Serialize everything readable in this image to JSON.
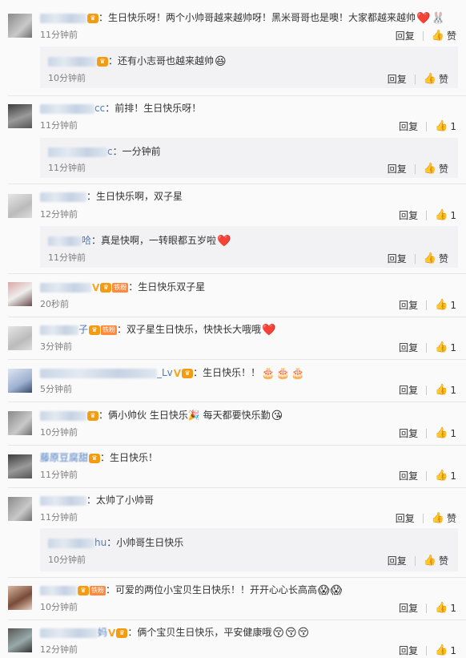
{
  "ui": {
    "reply_label": "回复",
    "like_label": "赞"
  },
  "comments": [
    {
      "name_tail": "",
      "badges": [
        "vip-badge"
      ],
      "text": "：生日快乐呀！两个小帅哥越来越帅呀！黑米哥哥也是噢！大家都越来越帅",
      "emojis": [
        "❤️",
        "🐰"
      ],
      "time": "11分钟前",
      "likes": "赞",
      "reply": {
        "name_tail": "",
        "text": "：还有小志哥也越来越帅",
        "emojis": [
          "😆"
        ],
        "time": "10分钟前",
        "likes": "赞"
      }
    },
    {
      "name_tail": "cc",
      "badges": [],
      "text": "：前排！生日快乐呀！",
      "emojis": [],
      "time": "11分钟前",
      "likes": "1",
      "reply": {
        "name_tail": "c",
        "text": "：一分钟前",
        "emojis": [],
        "time": "11分钟前",
        "likes": "赞"
      }
    },
    {
      "name_tail": "",
      "badges": [],
      "text": "：生日快乐啊，双子星",
      "emojis": [],
      "time": "12分钟前",
      "likes": "1",
      "reply": {
        "name_tail": "哈",
        "text": "：真是快啊，一转眼都五岁啦",
        "emojis": [
          "❤️"
        ],
        "time": "11分钟前",
        "likes": "赞"
      }
    },
    {
      "name_tail": "",
      "badges": [
        "V",
        "vip-badge",
        "铁粉"
      ],
      "text": "：生日快乐双子星",
      "emojis": [],
      "time": "20秒前",
      "likes": "1"
    },
    {
      "name_tail": "子",
      "badges": [
        "vip-badge",
        "铁粉"
      ],
      "text": "：双子星生日快乐，快快长大哦哦",
      "emojis": [
        "❤️"
      ],
      "time": "3分钟前",
      "likes": "1"
    },
    {
      "name_tail": "_Lv",
      "badges": [
        "V",
        "vip-badge"
      ],
      "text": "：生日快乐！！",
      "emojis": [
        "🎂",
        "🎂",
        "🎂"
      ],
      "time": "5分钟前",
      "likes": "1"
    },
    {
      "name_tail": "",
      "badges": [
        "vip-badge"
      ],
      "text": "：俩小帅伙 生日快乐🎉 每天都要快乐勤",
      "emojis": [
        "😘"
      ],
      "time": "10分钟前",
      "likes": "1"
    },
    {
      "name_tail": "藤原豆腐甜",
      "badges": [
        "vip-badge"
      ],
      "text": "：生日快乐！",
      "emojis": [],
      "time": "11分钟前",
      "likes": "1"
    },
    {
      "name_tail": "",
      "badges": [],
      "text": "：太帅了小帅哥",
      "emojis": [],
      "time": "11分钟前",
      "likes": "赞",
      "reply": {
        "name_tail": "hu",
        "text": "：小帅哥生日快乐",
        "emojis": [],
        "time": "10分钟前",
        "likes": "赞"
      }
    },
    {
      "name_tail": "",
      "badges": [
        "铁粉"
      ],
      "text": "：可爱的两位小宝贝生日快乐！！开开心心长高高",
      "emojis": [
        "😱",
        "😱"
      ],
      "time": "10分钟前",
      "likes": "1"
    },
    {
      "name_tail": "妈",
      "badges": [
        "V",
        "vip-badge"
      ],
      "text": "：俩个宝贝生日快乐，平安健康哦",
      "emojis": [
        "😚",
        "😚",
        "😚"
      ],
      "time": "12分钟前",
      "likes": "1"
    }
  ]
}
